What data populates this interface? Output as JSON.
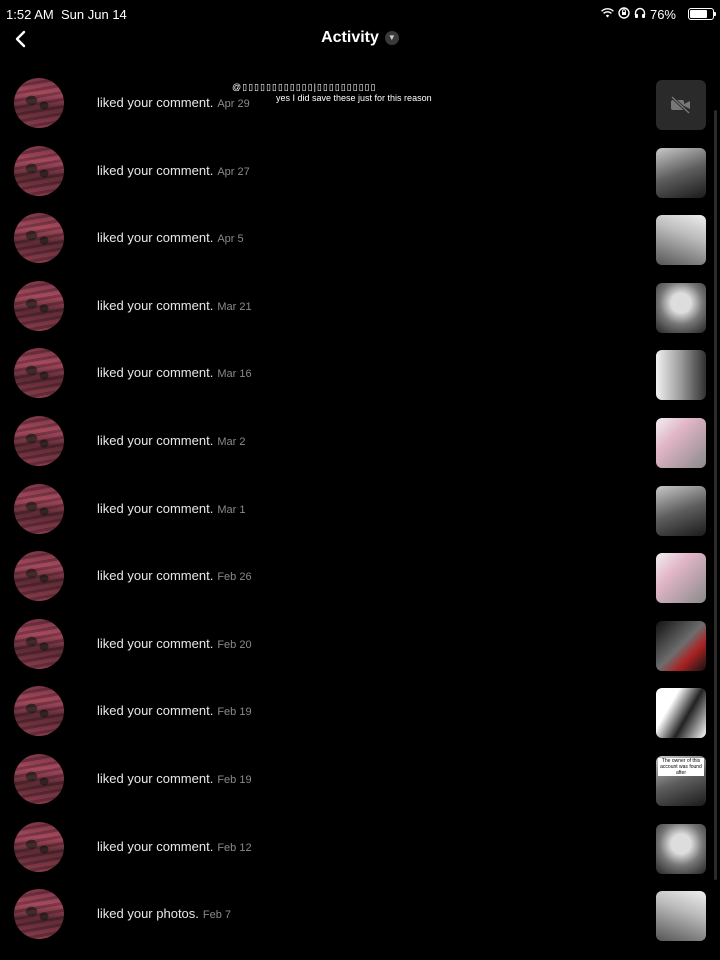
{
  "status_bar": {
    "time": "1:52 AM",
    "date": "Sun Jun 14",
    "battery": "76%",
    "battery_level": 0.76,
    "icons": [
      "wifi-icon",
      "lock-rotation-icon",
      "headphones-icon",
      "battery-icon"
    ]
  },
  "header": {
    "title": "Activity",
    "back_icon": "chevron-left-icon",
    "title_icon": "chevron-down-icon"
  },
  "overlay": {
    "line1": "@▯▯▯▯▯▯▯▯▯▯▯▯|▯▯▯▯▯▯▯▯▯▯",
    "line2": "yes I did save these just for this reason"
  },
  "rows": [
    {
      "text": "liked your comment.",
      "date": "Apr 29",
      "thumb": "video"
    },
    {
      "text": "liked your comment.",
      "date": "Apr 27",
      "thumb": "v1"
    },
    {
      "text": "liked your comment.",
      "date": "Apr 5",
      "thumb": "v2"
    },
    {
      "text": "liked your comment.",
      "date": "Mar 21",
      "thumb": "v3"
    },
    {
      "text": "liked your comment.",
      "date": "Mar 16",
      "thumb": "v4"
    },
    {
      "text": "liked your comment.",
      "date": "Mar 2",
      "thumb": "v5"
    },
    {
      "text": "liked your comment.",
      "date": "Mar 1",
      "thumb": "v1"
    },
    {
      "text": "liked your comment.",
      "date": "Feb 26",
      "thumb": "v5"
    },
    {
      "text": "liked your comment.",
      "date": "Feb 20",
      "thumb": "v6"
    },
    {
      "text": "liked your comment.",
      "date": "Feb 19",
      "thumb": "v7"
    },
    {
      "text": "liked your comment.",
      "date": "Feb 19",
      "thumb": "v1",
      "caption": "The owner of this account was found after"
    },
    {
      "text": "liked your comment.",
      "date": "Feb 12",
      "thumb": "v3"
    },
    {
      "text": "liked your photos.",
      "date": "Feb 7",
      "thumb": "v2"
    }
  ]
}
